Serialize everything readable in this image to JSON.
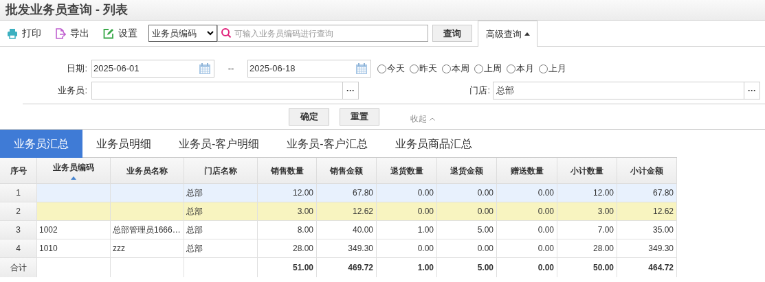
{
  "title": "批发业务员查询 - 列表",
  "toolbar": {
    "buttons": [
      {
        "kind": "print",
        "label": "打印"
      },
      {
        "kind": "export",
        "label": "导出"
      },
      {
        "kind": "settings",
        "label": "设置"
      }
    ],
    "search_field_select": "业务员编码",
    "search_placeholder": "可输入业务员编码进行查询",
    "search_button": "查询",
    "advanced_button": "高级查询",
    "advanced_expanded": true
  },
  "filters": {
    "date_label": "日期:",
    "date_from": "2025-06-01",
    "date_sep": "--",
    "date_to": "2025-06-18",
    "quick_ranges": [
      {
        "label": "今天",
        "selected": false
      },
      {
        "label": "昨天",
        "selected": false
      },
      {
        "label": "本周",
        "selected": false
      },
      {
        "label": "上周",
        "selected": false
      },
      {
        "label": "本月",
        "selected": false
      },
      {
        "label": "上月",
        "selected": false
      }
    ],
    "salesman_label": "业务员:",
    "store_label": "门店:",
    "store_value": "总部",
    "picker_button": "···",
    "confirm_button": "确定",
    "reset_button": "重置",
    "collapse_link": "收起"
  },
  "tabs": [
    {
      "label": "业务员汇总",
      "selected": true
    },
    {
      "label": "业务员明细",
      "selected": false
    },
    {
      "label": "业务员-客户明细",
      "selected": false
    },
    {
      "label": "业务员-客户汇总",
      "selected": false
    },
    {
      "label": "业务员商品汇总",
      "selected": false
    }
  ],
  "table": {
    "columns": [
      {
        "label": "序号",
        "sorted": false
      },
      {
        "label": "业务员编码",
        "sorted": true
      },
      {
        "label": "业务员名称",
        "sorted": false
      },
      {
        "label": "门店名称",
        "sorted": false
      },
      {
        "label": "销售数量",
        "sorted": false
      },
      {
        "label": "销售金额",
        "sorted": false
      },
      {
        "label": "退货数量",
        "sorted": false
      },
      {
        "label": "退货金额",
        "sorted": false
      },
      {
        "label": "赠送数量",
        "sorted": false
      },
      {
        "label": "小计数量",
        "sorted": false
      },
      {
        "label": "小计金额",
        "sorted": false
      }
    ],
    "rows": [
      {
        "hovered": true,
        "selected": false,
        "cells": [
          "1",
          null,
          null,
          "总部",
          "12.00",
          "67.80",
          "0.00",
          "0.00",
          "0.00",
          "12.00",
          "67.80"
        ]
      },
      {
        "hovered": false,
        "selected": true,
        "cells": [
          "2",
          null,
          null,
          "总部",
          "3.00",
          "12.62",
          "0.00",
          "0.00",
          "0.00",
          "3.00",
          "12.62"
        ]
      },
      {
        "hovered": false,
        "selected": false,
        "cells": [
          "3",
          "1002",
          "总部管理员1666…",
          "总部",
          "8.00",
          "40.00",
          "1.00",
          "5.00",
          "0.00",
          "7.00",
          "35.00"
        ]
      },
      {
        "hovered": false,
        "selected": false,
        "cells": [
          "4",
          "1010",
          "zzz",
          "总部",
          "28.00",
          "349.30",
          "0.00",
          "0.00",
          "0.00",
          "28.00",
          "349.30"
        ]
      }
    ],
    "totals": {
      "label": "合计",
      "values": [
        "51.00",
        "469.72",
        "1.00",
        "5.00",
        "0.00",
        "50.00",
        "464.72"
      ]
    }
  }
}
